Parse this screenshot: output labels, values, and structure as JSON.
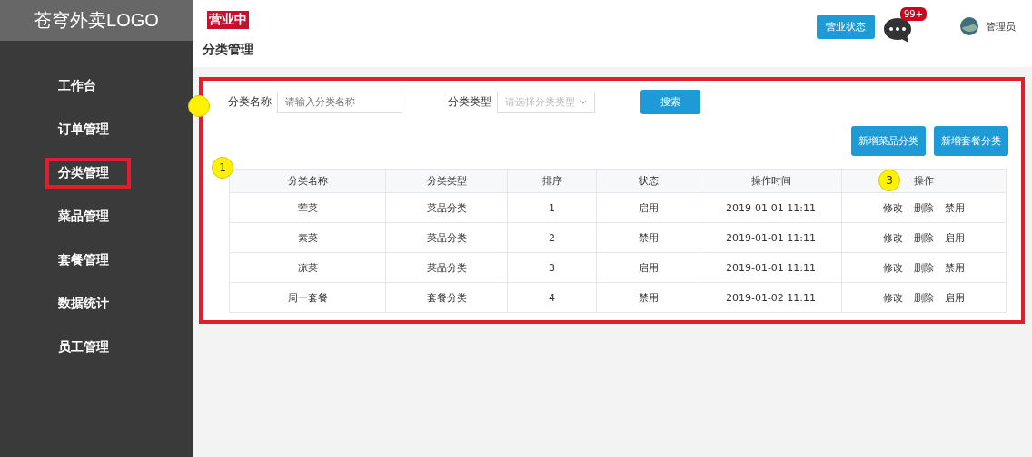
{
  "sidebar": {
    "logo": "苍穹外卖LOGO",
    "items": [
      {
        "label": "工作台",
        "selected": false
      },
      {
        "label": "订单管理",
        "selected": false
      },
      {
        "label": "分类管理",
        "selected": true
      },
      {
        "label": "菜品管理",
        "selected": false
      },
      {
        "label": "套餐管理",
        "selected": false
      },
      {
        "label": "数据统计",
        "selected": false
      },
      {
        "label": "员工管理",
        "selected": false
      }
    ]
  },
  "header": {
    "status_badge": "营业中",
    "status_button": "营业状态",
    "message_count": "99+",
    "user": "管理员"
  },
  "page_title": "分类管理",
  "filters": [
    {
      "kind": "input",
      "label": "分类名称",
      "placeholder": "请输入分类名称"
    },
    {
      "kind": "select",
      "label": "分类类型",
      "placeholder": "请选择分类类型"
    }
  ],
  "search_button": "搜索",
  "actions": [
    "新增菜品分类",
    "新增套餐分类"
  ],
  "table": {
    "columns": [
      "分类名称",
      "分类类型",
      "排序",
      "状态",
      "操作时间",
      "操作"
    ],
    "rows": [
      {
        "cells": [
          "荤菜",
          "菜品分类",
          "1",
          "启用",
          "2019-01-01 11:11"
        ],
        "operations": [
          "修改",
          "删除",
          "禁用"
        ]
      },
      {
        "cells": [
          "素菜",
          "菜品分类",
          "2",
          "禁用",
          "2019-01-01 11:11"
        ],
        "operations": [
          "修改",
          "删除",
          "启用"
        ]
      },
      {
        "cells": [
          "凉菜",
          "菜品分类",
          "3",
          "启用",
          "2019-01-01 11:11"
        ],
        "operations": [
          "修改",
          "删除",
          "禁用"
        ]
      },
      {
        "cells": [
          "周一套餐",
          "套餐分类",
          "4",
          "禁用",
          "2019-01-02 11:11"
        ],
        "operations": [
          "修改",
          "删除",
          "启用"
        ]
      }
    ]
  },
  "annotations": [
    {
      "label": "1"
    },
    {
      "label": "3"
    }
  ]
}
